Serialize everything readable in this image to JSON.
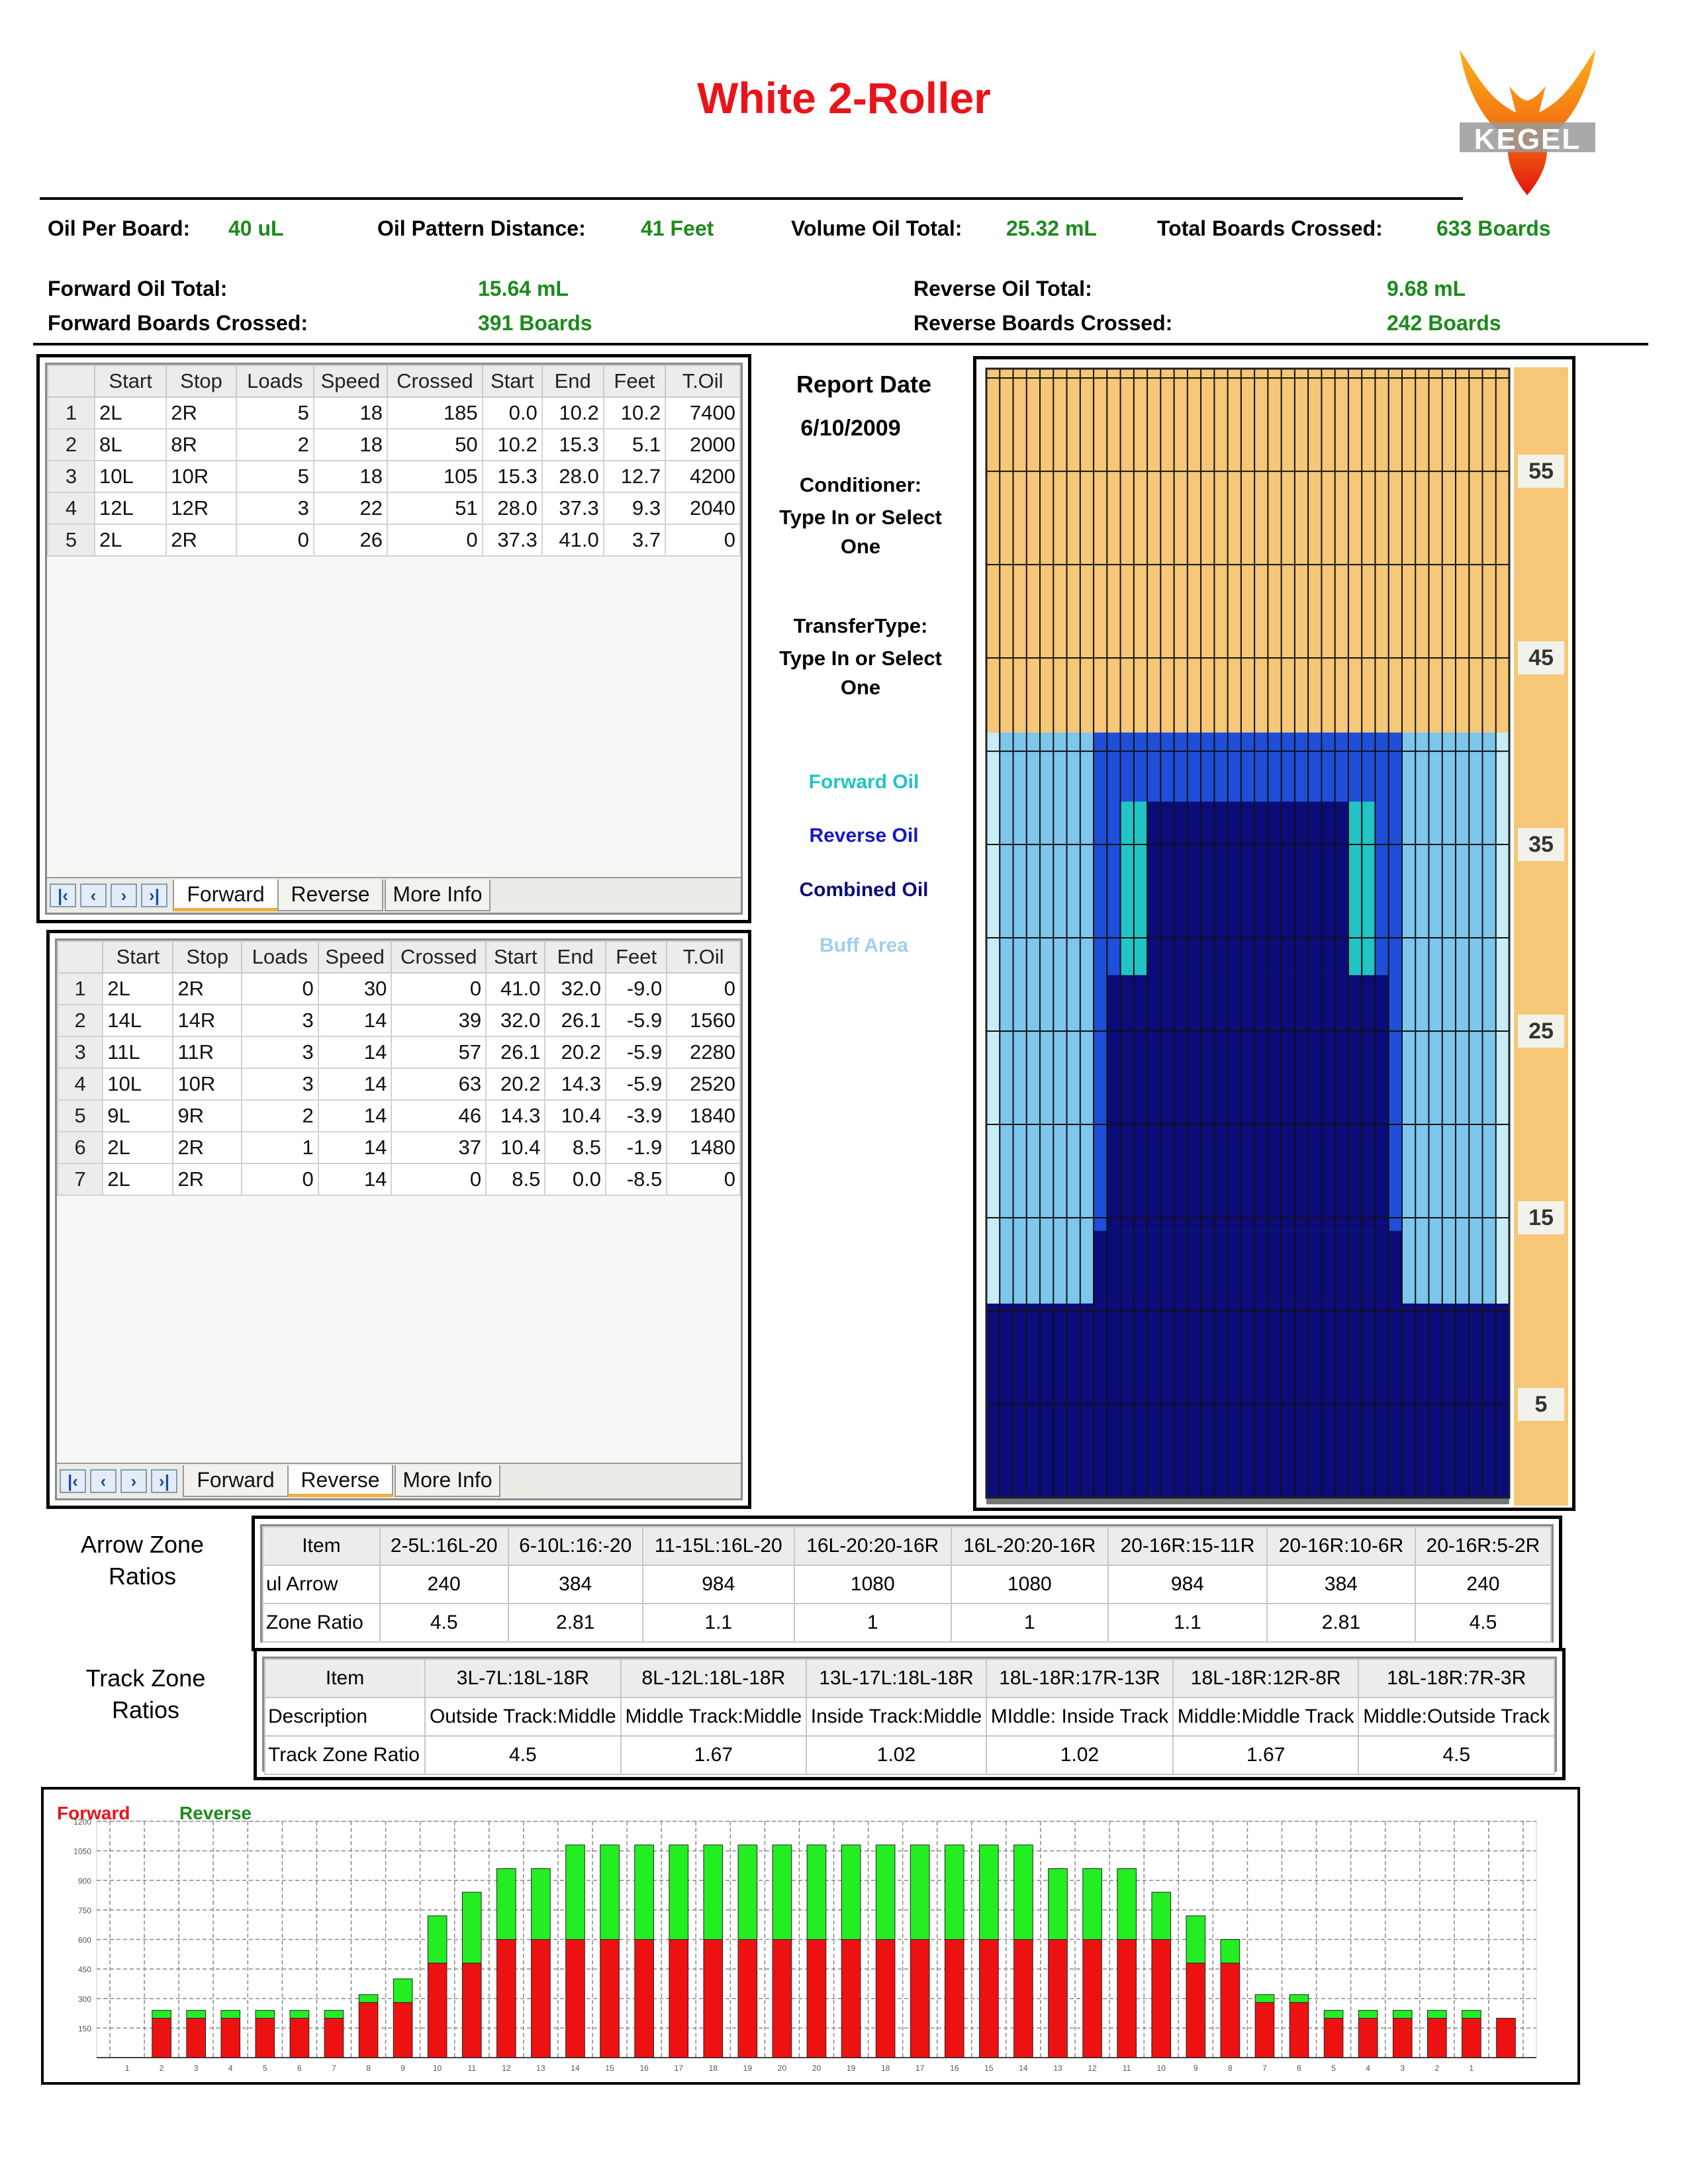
{
  "title": "White 2-Roller",
  "logo_text": "KEGEL",
  "summary": {
    "oil_per_board_label": "Oil Per Board:",
    "oil_per_board": "40 uL",
    "pattern_distance_label": "Oil Pattern Distance:",
    "pattern_distance": "41 Feet",
    "volume_total_label": "Volume Oil Total:",
    "volume_total": "25.32 mL",
    "boards_crossed_label": "Total Boards Crossed:",
    "boards_crossed": "633 Boards",
    "forward_total_label": "Forward Oil Total:",
    "forward_total": "15.64 mL",
    "forward_boards_label": "Forward Boards Crossed:",
    "forward_boards": "391 Boards",
    "reverse_total_label": "Reverse Oil Total:",
    "reverse_total": "9.68 mL",
    "reverse_boards_label": "Reverse Boards Crossed:",
    "reverse_boards": "242 Boards"
  },
  "columns": [
    "Start",
    "Stop",
    "Loads",
    "Speed",
    "Crossed",
    "Start",
    "End",
    "Feet",
    "T.Oil"
  ],
  "forward_rows": [
    [
      "1",
      "2L",
      "2R",
      "5",
      "18",
      "185",
      "0.0",
      "10.2",
      "10.2",
      "7400"
    ],
    [
      "2",
      "8L",
      "8R",
      "2",
      "18",
      "50",
      "10.2",
      "15.3",
      "5.1",
      "2000"
    ],
    [
      "3",
      "10L",
      "10R",
      "5",
      "18",
      "105",
      "15.3",
      "28.0",
      "12.7",
      "4200"
    ],
    [
      "4",
      "12L",
      "12R",
      "3",
      "22",
      "51",
      "28.0",
      "37.3",
      "9.3",
      "2040"
    ],
    [
      "5",
      "2L",
      "2R",
      "0",
      "26",
      "0",
      "37.3",
      "41.0",
      "3.7",
      "0"
    ]
  ],
  "reverse_rows": [
    [
      "1",
      "2L",
      "2R",
      "0",
      "30",
      "0",
      "41.0",
      "32.0",
      "-9.0",
      "0"
    ],
    [
      "2",
      "14L",
      "14R",
      "3",
      "14",
      "39",
      "32.0",
      "26.1",
      "-5.9",
      "1560"
    ],
    [
      "3",
      "11L",
      "11R",
      "3",
      "14",
      "57",
      "26.1",
      "20.2",
      "-5.9",
      "2280"
    ],
    [
      "4",
      "10L",
      "10R",
      "3",
      "14",
      "63",
      "20.2",
      "14.3",
      "-5.9",
      "2520"
    ],
    [
      "5",
      "9L",
      "9R",
      "2",
      "14",
      "46",
      "14.3",
      "10.4",
      "-3.9",
      "1840"
    ],
    [
      "6",
      "2L",
      "2R",
      "1",
      "14",
      "37",
      "10.4",
      "8.5",
      "-1.9",
      "1480"
    ],
    [
      "7",
      "2L",
      "2R",
      "0",
      "14",
      "0",
      "8.5",
      "0.0",
      "-8.5",
      "0"
    ]
  ],
  "tabs": [
    "Forward",
    "Reverse",
    "More Info"
  ],
  "nav_icons": [
    "first-icon",
    "prev-icon",
    "next-icon",
    "last-icon"
  ],
  "report": {
    "date_label": "Report Date",
    "date": "6/10/2009",
    "conditioner_label": "Conditioner:",
    "conditioner_value": "Type In or Select One",
    "transfer_label": "TransferType:",
    "transfer_value": "Type In or Select One"
  },
  "legend": {
    "forward": "Forward Oil",
    "reverse": "Reverse Oil",
    "combined": "Combined Oil",
    "buff": "Buff Area",
    "forward_color": "#22c4c4",
    "reverse_color": "#1717c8",
    "combined_color": "#0b0b7a",
    "buff_color": "#9fd0ea"
  },
  "lane_scale": [
    "55",
    "45",
    "35",
    "25",
    "15",
    "5"
  ],
  "arrow_zone": {
    "label": "Arrow Zone Ratios",
    "header": [
      "Item",
      "2-5L:16L-20",
      "6-10L:16:-20",
      "11-15L:16L-20",
      "16L-20:20-16R",
      "16L-20:20-16R",
      "20-16R:15-11R",
      "20-16R:10-6R",
      "20-16R:5-2R"
    ],
    "rows": [
      [
        "ul Arrow",
        "240",
        "384",
        "984",
        "1080",
        "1080",
        "984",
        "384",
        "240"
      ],
      [
        "Zone Ratio",
        "4.5",
        "2.81",
        "1.1",
        "1",
        "1",
        "1.1",
        "2.81",
        "4.5"
      ]
    ]
  },
  "track_zone": {
    "label": "Track Zone Ratios",
    "header": [
      "Item",
      "3L-7L:18L-18R",
      "8L-12L:18L-18R",
      "13L-17L:18L-18R",
      "18L-18R:17R-13R",
      "18L-18R:12R-8R",
      "18L-18R:7R-3R"
    ],
    "rows": [
      [
        "Description",
        "Outside Track:Middle",
        "Middle Track:Middle",
        "Inside Track:Middle",
        "MIddle: Inside Track",
        "Middle:Middle Track",
        "Middle:Outside Track"
      ],
      [
        "Track Zone Ratio",
        "4.5",
        "1.67",
        "1.02",
        "1.02",
        "1.67",
        "4.5"
      ]
    ]
  },
  "chart_data": {
    "type": "bar",
    "stacked": true,
    "series": [
      {
        "name": "Forward",
        "color": "#ee1111",
        "values": [
          0,
          200,
          200,
          200,
          200,
          200,
          200,
          280,
          280,
          480,
          480,
          600,
          600,
          600,
          600,
          600,
          600,
          600,
          600,
          600,
          600,
          600,
          600,
          600,
          600,
          600,
          600,
          600,
          600,
          600,
          600,
          480,
          480,
          280,
          280,
          200,
          200,
          200,
          200,
          200,
          200,
          0
        ]
      },
      {
        "name": "Reverse",
        "color": "#22ee22",
        "values": [
          0,
          40,
          40,
          40,
          40,
          40,
          40,
          40,
          120,
          240,
          360,
          360,
          360,
          480,
          480,
          480,
          480,
          480,
          480,
          480,
          480,
          480,
          480,
          480,
          480,
          480,
          480,
          360,
          360,
          360,
          240,
          240,
          120,
          40,
          40,
          40,
          40,
          40,
          40,
          40,
          0,
          0
        ]
      }
    ],
    "categories": [
      "1",
      "2",
      "3",
      "4",
      "5",
      "6",
      "7",
      "8",
      "9",
      "10",
      "11",
      "12",
      "13",
      "14",
      "15",
      "16",
      "17",
      "18",
      "19",
      "20",
      "20",
      "19",
      "18",
      "17",
      "16",
      "15",
      "14",
      "13",
      "12",
      "11",
      "10",
      "9",
      "8",
      "7",
      "6",
      "5",
      "4",
      "3",
      "2",
      "1"
    ],
    "yticks": [
      "150",
      "300",
      "450",
      "600",
      "750",
      "900",
      "1050",
      "1200"
    ],
    "ylim": [
      0,
      1200
    ],
    "grid": true
  }
}
